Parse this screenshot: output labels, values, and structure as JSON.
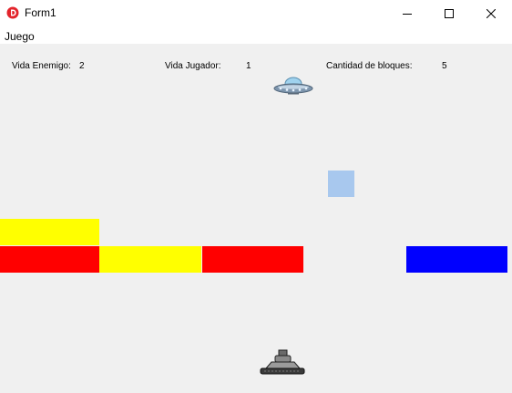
{
  "window": {
    "title": "Form1",
    "icon": "delphi-app-icon",
    "controls": [
      "minimize-icon",
      "maximize-icon",
      "close-icon"
    ]
  },
  "menu": {
    "items": [
      {
        "label": "Juego"
      }
    ]
  },
  "hud": {
    "enemy_life_label": "Vida Enemigo:",
    "enemy_life_value": "2",
    "player_life_label": "Vida Jugador:",
    "player_life_value": "1",
    "block_count_label": "Cantidad de bloques:",
    "block_count_value": "5"
  },
  "game": {
    "background_color": "#f0f0f0",
    "enemy": "ufo-sprite",
    "player": "tank-sprite",
    "projectile_color": "#a8c8ee",
    "blocks": [
      {
        "color": "#ffff00"
      },
      {
        "color": "#ff0000"
      },
      {
        "color": "#ffff00"
      },
      {
        "color": "#ff0000"
      },
      {
        "color": "#0000ff"
      }
    ]
  }
}
